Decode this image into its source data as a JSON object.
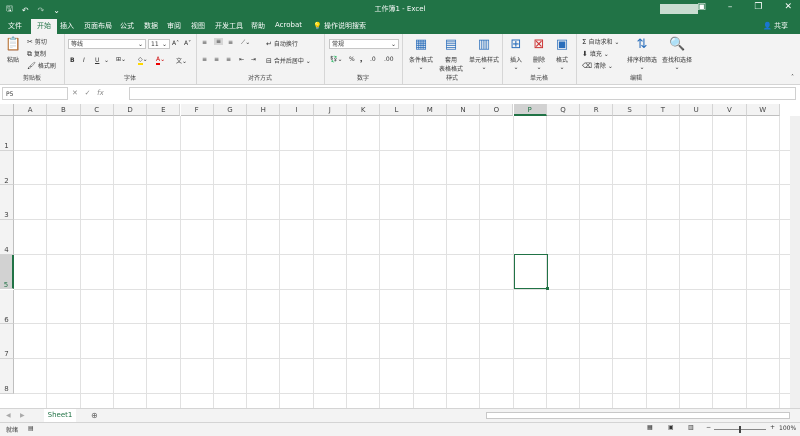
{
  "window": {
    "title": "工作簿1 - Excel",
    "share_label": "共享"
  },
  "ribbon_tabs": [
    "文件",
    "开始",
    "插入",
    "页面布局",
    "公式",
    "数据",
    "审阅",
    "视图",
    "开发工具",
    "帮助",
    "Acrobat",
    "操作说明搜索"
  ],
  "active_tab": "开始",
  "clipboard": {
    "paste": "粘贴",
    "cut": "剪切",
    "copy": "复制",
    "format_painter": "格式刷",
    "label": "剪贴板"
  },
  "font": {
    "name": "等线",
    "size": "11",
    "label": "字体",
    "bold": "B",
    "italic": "I",
    "underline": "U"
  },
  "alignment": {
    "wrap": "自动换行",
    "merge": "合并后居中",
    "label": "对齐方式"
  },
  "number": {
    "format": "常规",
    "label": "数字"
  },
  "styles": {
    "conditional": "条件格式",
    "table_l1": "套用",
    "table_l2": "表格格式",
    "cell_styles": "单元格样式",
    "label": "样式"
  },
  "cells": {
    "insert": "插入",
    "delete": "删除",
    "format": "格式",
    "label": "单元格"
  },
  "editing": {
    "autosum": "自动求和",
    "fill": "填充",
    "clear": "清除",
    "sort": "排序和筛选",
    "find": "查找和选择",
    "label": "编辑"
  },
  "formula_bar": {
    "name_box": "P5",
    "fx": "fx"
  },
  "columns": [
    "A",
    "B",
    "C",
    "D",
    "E",
    "F",
    "G",
    "H",
    "I",
    "J",
    "K",
    "L",
    "M",
    "N",
    "O",
    "P",
    "Q",
    "R",
    "S",
    "T",
    "U",
    "V",
    "W"
  ],
  "selected_column": "P",
  "rows": [
    "1",
    "2",
    "3",
    "4",
    "5",
    "6",
    "7",
    "8"
  ],
  "selected_row": "5",
  "sheets": [
    "Sheet1"
  ],
  "status": {
    "ready": "就绪",
    "zoom": "100%"
  }
}
